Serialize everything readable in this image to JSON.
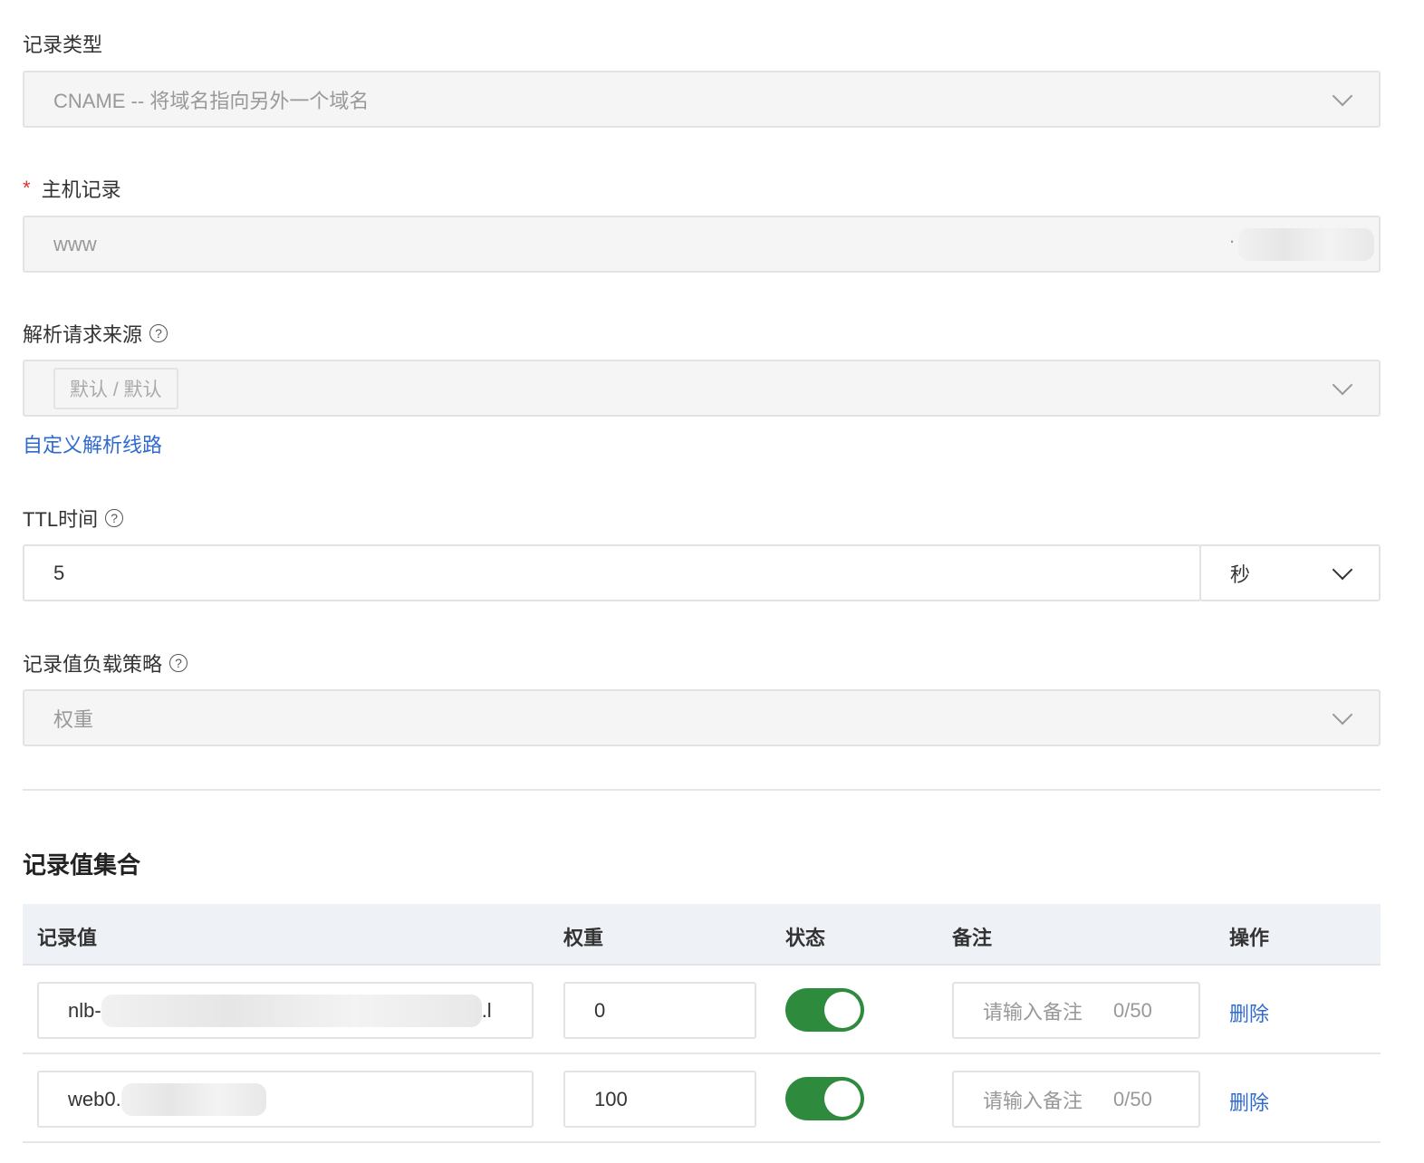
{
  "record_type": {
    "label": "记录类型",
    "value": "CNAME -- 将域名指向另外一个域名"
  },
  "host": {
    "label": "主机记录",
    "required_mark": "*",
    "value": "www",
    "suffix": "."
  },
  "source": {
    "label": "解析请求来源",
    "tag": "默认 / 默认",
    "link": "自定义解析线路"
  },
  "ttl": {
    "label": "TTL时间",
    "value": "5",
    "unit": "秒"
  },
  "strategy": {
    "label": "记录值负载策略",
    "value": "权重"
  },
  "records": {
    "title": "记录值集合",
    "headers": [
      "记录值",
      "权重",
      "状态",
      "备注",
      "操作"
    ],
    "rows": [
      {
        "value": "nlb-",
        "value_tail": ".l",
        "weight": "0",
        "enabled": true,
        "remark_placeholder": "请输入备注",
        "count": "0/50",
        "action": "删除"
      },
      {
        "value": "web0.",
        "weight": "100",
        "enabled": true,
        "remark_placeholder": "请输入备注",
        "count": "0/50",
        "action": "删除"
      }
    ]
  },
  "colors": {
    "accent": "#2f6ad0",
    "toggle_on": "#2e8b3e",
    "table_header": "#eef1f6"
  }
}
